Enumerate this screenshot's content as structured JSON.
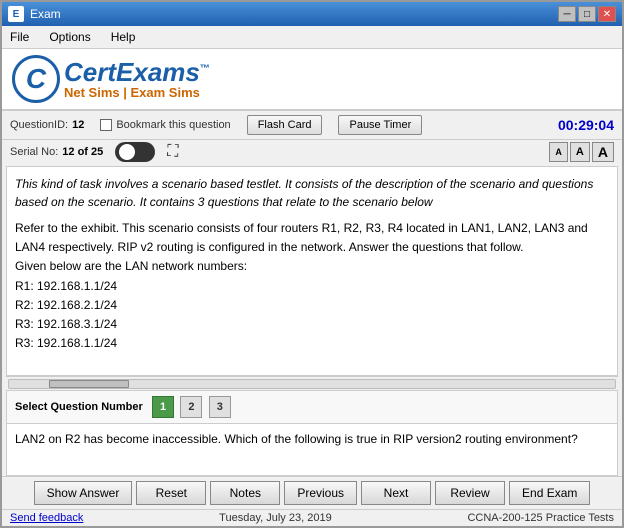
{
  "window": {
    "title": "Exam",
    "icon": "E"
  },
  "menu": {
    "items": [
      "File",
      "Options",
      "Help"
    ]
  },
  "logo": {
    "letter": "C",
    "brand": "ertExams",
    "tm": "™",
    "tagline": "Net Sims | Exam Sims"
  },
  "info_bar": {
    "question_id_label": "QuestionID:",
    "question_id_value": "12",
    "serial_label": "Serial No:",
    "serial_value": "12 of 25",
    "bookmark_label": "Bookmark this question",
    "flash_card_btn": "Flash Card",
    "pause_timer_btn": "Pause Timer",
    "timer": "00:29:04"
  },
  "font_btns": {
    "small": "A",
    "medium": "A",
    "large": "A"
  },
  "content": {
    "scenario_text": "This kind of task involves a scenario based testlet. It consists of the description of the scenario and questions based on the scenario. It contains 3 questions that relate to the scenario below",
    "body_text": "Refer to the exhibit. This scenario consists of four routers R1, R2, R3, R4 located in LAN1, LAN2, LAN3 and LAN4 respectively. RIP v2 routing is configured in the network. Answer the questions that follow.\nGiven below are the LAN network numbers:\nR1: 192.168.1.1/24\nR2: 192.168.2.1/24\nR3: 192.168.3.1/24\nR3: 192.168.1.1/24"
  },
  "question_selector": {
    "label": "Select Question Number",
    "buttons": [
      {
        "num": "1",
        "active": true
      },
      {
        "num": "2",
        "active": false
      },
      {
        "num": "3",
        "active": false
      }
    ]
  },
  "question_text": "LAN2 on R2 has become inaccessible. Which of the following is true in RIP version2 routing environment?",
  "bottom_buttons": {
    "show_answer": "Show Answer",
    "reset": "Reset",
    "notes": "Notes",
    "previous": "Previous",
    "next": "Next",
    "review": "Review",
    "end_exam": "End Exam"
  },
  "status_bar": {
    "feedback": "Send feedback",
    "date": "Tuesday, July 23, 2019",
    "exam": "CCNA-200-125 Practice Tests"
  }
}
